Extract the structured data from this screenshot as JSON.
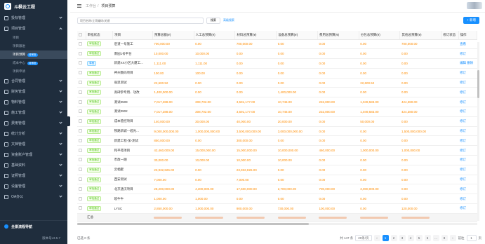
{
  "app": {
    "name": "斗枫云工程",
    "version": "版本号v3.5.7"
  },
  "sidebar": {
    "menus": [
      {
        "label": "投标管理",
        "icon": "document-icon",
        "open": false
      },
      {
        "label": "项目管理",
        "icon": "folder-icon",
        "open": true,
        "children": [
          {
            "label": "项目",
            "active": false,
            "badge": ""
          },
          {
            "label": "项目跟进",
            "active": false,
            "badge": ""
          },
          {
            "label": "项目预算",
            "active": true,
            "badge": "待审批"
          },
          {
            "label": "成本中心",
            "active": false,
            "badge": "待审批"
          },
          {
            "label": "项目申请",
            "active": false,
            "badge": ""
          }
        ]
      },
      {
        "label": "合同管理",
        "icon": "contract-icon",
        "open": false
      },
      {
        "label": "财务管理",
        "icon": "money-icon",
        "open": false
      },
      {
        "label": "物料管理",
        "icon": "box-icon",
        "open": false
      },
      {
        "label": "施工管理",
        "icon": "build-icon",
        "open": false
      },
      {
        "label": "费用管理",
        "icon": "expense-icon",
        "open": false
      },
      {
        "label": "统计分析",
        "icon": "chart-icon",
        "open": false
      },
      {
        "label": "文档管理",
        "icon": "file-icon",
        "open": false
      },
      {
        "label": "资金账户管理",
        "icon": "account-icon",
        "open": false
      },
      {
        "label": "基础资料",
        "icon": "database-icon",
        "open": false
      },
      {
        "label": "证照管理",
        "icon": "license-icon",
        "open": false
      },
      {
        "label": "设备管理",
        "icon": "device-icon",
        "open": false
      },
      {
        "label": "OA办公",
        "icon": "office-icon",
        "open": false
      }
    ],
    "footer_nav": "全景流程导航"
  },
  "breadcrumb": {
    "root": "工作台",
    "sep": "/",
    "current": "项目预算"
  },
  "filter": {
    "placeholder": "项目名称/立项编码/关键",
    "search": "搜索",
    "advanced": "高级搜索",
    "add": "+ 新增"
  },
  "table": {
    "headers": [
      "",
      "审批状态",
      "项目",
      "预算总额(¥)",
      "人工总预算(¥)",
      "材料总预算(¥)",
      "设备总预算(¥)",
      "费用总预算(¥)",
      "分包总预算(¥)",
      "其他总预算(¥)",
      "修订状态",
      "操作"
    ],
    "rows": [
      {
        "status": "审批通过",
        "sc": "green",
        "project": "后道一号施工",
        "total": "700,000.00",
        "labor": "0.00",
        "material": "700,000.00",
        "equip": "0.00",
        "fee": "0.00",
        "sub": "0.00",
        "other": "700,000.00",
        "op": "查看"
      },
      {
        "status": "审批通过",
        "sc": "green",
        "project": "南园1号平台",
        "total": "10,000.00",
        "labor": "10,000.00",
        "material": "0.00",
        "equip": "0.00",
        "fee": "0.00",
        "sub": "0.00",
        "other": "0.00",
        "op": "修订"
      },
      {
        "status": "草稿",
        "sc": "blue",
        "project": "新建XX小区大厦工...",
        "total": "1,111.00",
        "labor": "1,111.00",
        "material": "0.00",
        "equip": "0.00",
        "fee": "0.00",
        "sub": "0.00",
        "other": "0.00",
        "op": "编辑  删除"
      },
      {
        "status": "审批通过",
        "sc": "green",
        "project": "神州数码项目",
        "total": "100.00",
        "labor": "100.00",
        "material": "0.00",
        "equip": "0.00",
        "fee": "0.00",
        "sub": "0.00",
        "other": "0.00",
        "op": "修订"
      },
      {
        "status": "审批通过",
        "sc": "green",
        "project": "张思测试",
        "total": "22,600.52",
        "labor": "0.00",
        "material": "0.00",
        "equip": "0.00",
        "fee": "0.00",
        "sub": "22,600.52",
        "other": "0.00",
        "op": "修订"
      },
      {
        "status": "审批通过",
        "sc": "green",
        "project": "高碑参专用、功改",
        "total": "1,400,000.00",
        "labor": "0.00",
        "material": "0.00",
        "equip": "1,400,000.00",
        "fee": "0.00",
        "sub": "0.00",
        "other": "0.00",
        "op": "修订"
      },
      {
        "status": "审批通过",
        "sc": "green",
        "project": "测试0509",
        "total": "7,017,388.00",
        "labor": "308,702.00",
        "material": "3,591,177.00",
        "equip": "10,746.00",
        "fee": "232,800.00",
        "sub": "1,049,583.00",
        "other": "424,380.00",
        "op": "修订"
      },
      {
        "status": "审批通过",
        "sc": "green",
        "project": "测试0902",
        "total": "7,017,388.00",
        "labor": "308,702.00",
        "material": "3,591,177.00",
        "equip": "10,746.00",
        "fee": "232,800.00",
        "sub": "1,049,583.00",
        "other": "424,380.00",
        "op": "修订"
      },
      {
        "status": "审批通过",
        "sc": "green",
        "project": "成本管控项目",
        "total": "140,000.00",
        "labor": "30,000.00",
        "material": "40,000.00",
        "equip": "20,000.00",
        "fee": "0.00",
        "sub": "50,000.00",
        "other": "0.00",
        "op": "修订"
      },
      {
        "status": "审批通过",
        "sc": "green",
        "project": "铁路新城---旭光...",
        "total": "9,000,000,000.00",
        "labor": "1,000,000,000.00",
        "material": "3,500,000,000.00",
        "equip": "3,000,000,000.00",
        "fee": "0.00",
        "sub": "0.00",
        "other": "1,500,000,000.00",
        "op": "修订"
      },
      {
        "status": "审批通过",
        "sc": "green",
        "project": "新建工程-加-测试",
        "total": "850,000.00",
        "labor": "0.00",
        "material": "300,000.00",
        "equip": "0.00",
        "fee": "0.00",
        "sub": "0.00",
        "other": "0.00",
        "op": "修订"
      },
      {
        "status": "审批通过",
        "sc": "green",
        "project": "和平苑项目",
        "total": "42,460,000.00",
        "labor": "15,000,000.00",
        "material": "15,000,000.00",
        "equip": "10,000,000.00",
        "fee": "460,000.00",
        "sub": "1,000,000.00",
        "other": "1,000,000.00",
        "op": "修订"
      },
      {
        "status": "审批通过",
        "sc": "green",
        "project": "市政一期",
        "total": "30,000.00",
        "labor": "10,000.00",
        "material": "10,000.00",
        "equip": "10,000.00",
        "fee": "0.00",
        "sub": "0.00",
        "other": "0.00",
        "op": "修订"
      },
      {
        "status": "审批通过",
        "sc": "green",
        "project": "云栖墅",
        "total": "23,932,826.00",
        "labor": "0.00",
        "material": "23,932,826.00",
        "equip": "0.00",
        "fee": "0.00",
        "sub": "0.00",
        "other": "0.00",
        "op": "修订"
      },
      {
        "status": "审批通过",
        "sc": "green",
        "project": "西安测试",
        "total": "7,000.00",
        "labor": "0.00",
        "material": "7,000.00",
        "equip": "0.00",
        "fee": "0.00",
        "sub": "0.00",
        "other": "0.00",
        "op": "修订"
      },
      {
        "status": "审批通过",
        "sc": "green",
        "project": "北京通汉项目",
        "total": "28,200,000.00",
        "labor": "4,300,000.00",
        "material": "17,500,000.00",
        "equip": "2,700,000.00",
        "fee": "700,000.00",
        "sub": "3,000,000.00",
        "other": "0.00",
        "op": "修订"
      },
      {
        "status": "审批通过",
        "sc": "green",
        "project": "皖牛牛",
        "total": "1,000.00",
        "labor": "1,000.00",
        "material": "0.00",
        "equip": "0.00",
        "fee": "0.00",
        "sub": "0.00",
        "other": "0.00",
        "op": "修订"
      },
      {
        "status": "审批通过",
        "sc": "green",
        "project": "LYSC",
        "total": "2,850,000.00",
        "labor": "1,000,000.00",
        "material": "900,000.00",
        "equip": "730,000.00",
        "fee": "100,000.00",
        "sub": "0.00",
        "other": "120,000.00",
        "op": "修订"
      }
    ],
    "summary_label": "汇总"
  },
  "footer": {
    "selected": "已选 0 条",
    "total": "共 147 条",
    "page_size": "20条/页",
    "pages": [
      "1",
      "2",
      "3",
      "4",
      "5",
      "6",
      "...",
      "8"
    ],
    "jump_label": "前往",
    "jump_value": "1",
    "page_unit": "页"
  }
}
